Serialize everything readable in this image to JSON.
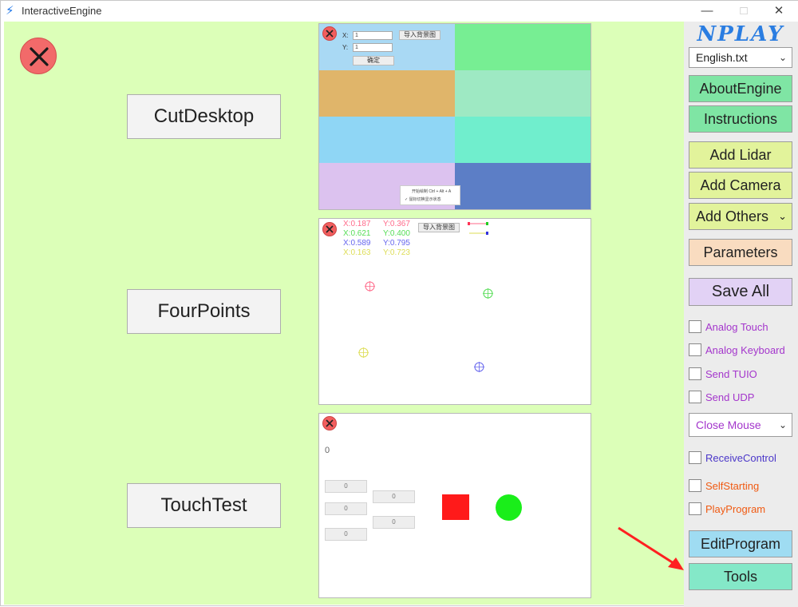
{
  "window": {
    "title": "InteractiveEngine",
    "minimize": "—",
    "maximize": "□",
    "close": "✕"
  },
  "main": {
    "close_icon": "close-icon",
    "modes": [
      {
        "label": "CutDesktop"
      },
      {
        "label": "FourPoints"
      },
      {
        "label": "TouchTest"
      }
    ]
  },
  "preview_cut": {
    "x_label": "X:",
    "y_label": "Y:",
    "x_value": "1",
    "y_value": "1",
    "import_bg": "导入背景图",
    "ok": "确定",
    "hint_line1": "开始绘制 Ctrl + Alt + A",
    "hint_line2": "✓ 鼠标切换显示状态",
    "colors": [
      "#a9d9f4",
      "#77ee93",
      "#e0b56a",
      "#9ee9c3",
      "#8fd6f5",
      "#70eecd",
      "#dcc2ef",
      "#5c7ec6"
    ]
  },
  "preview_four": {
    "import_bg": "导入背景图",
    "coords": [
      {
        "x": "X:0.187",
        "y": "Y:0.367",
        "color": "#ff6a8a"
      },
      {
        "x": "X:0.621",
        "y": "Y:0.400",
        "color": "#55dd55"
      },
      {
        "x": "X:0.589",
        "y": "Y:0.795",
        "color": "#6666ee"
      },
      {
        "x": "X:0.163",
        "y": "Y:0.723",
        "color": "#dddd55"
      }
    ]
  },
  "preview_touch": {
    "count": "0",
    "fields": [
      "0",
      "0",
      "0",
      "0",
      "0"
    ],
    "square_color": "#ff1a1a",
    "circle_color": "#1aee1a"
  },
  "sidebar": {
    "logo": "NPLAY",
    "file_select": "English.txt",
    "about": "AboutEngine",
    "instructions": "Instructions",
    "add_lidar": "Add Lidar",
    "add_camera": "Add Camera",
    "add_others": "Add Others",
    "parameters": "Parameters",
    "save_all": "Save All",
    "checks_top": [
      "Analog Touch",
      "Analog Keyboard",
      "Send TUIO",
      "Send UDP"
    ],
    "mouse_select": "Close Mouse",
    "receive_control": "ReceiveControl",
    "self_starting": "SelfStarting",
    "play_program": "PlayProgram",
    "edit_program": "EditProgram",
    "tools": "Tools",
    "colors": {
      "green_btn": "#7fe5a4",
      "yellow_btn": "#e2f39b",
      "orange_btn": "#f9dcc0",
      "purple_btn": "#e2d2f5",
      "blue_btn": "#9fdcf2",
      "teal_btn": "#84e8c8",
      "purple_text": "#a436cc",
      "indigo_text": "#4b37c9",
      "orange_text": "#f05a12"
    }
  }
}
